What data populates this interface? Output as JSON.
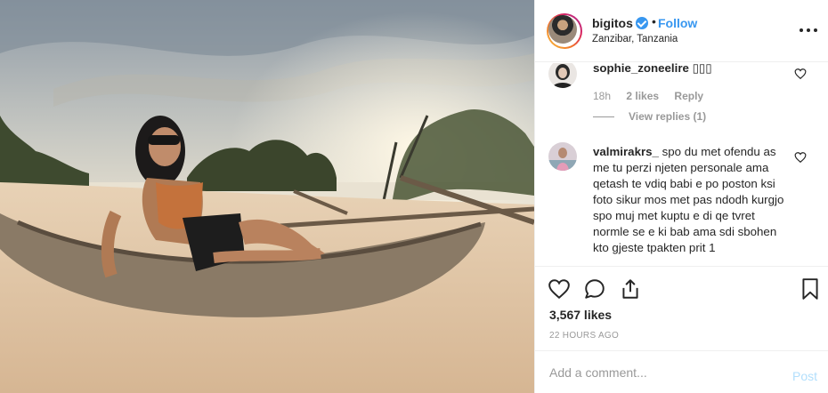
{
  "post": {
    "username": "bigitos",
    "follow_label": "Follow",
    "separator": "•",
    "location": "Zanzibar, Tanzania",
    "likes": "3,567 likes",
    "time_ago": "22 HOURS AGO"
  },
  "comments": [
    {
      "username": "sophie_zoneelire",
      "text": "▯▯▯",
      "time": "18h",
      "likes": "2 likes",
      "reply_label": "Reply",
      "view_replies": "View replies (1)"
    },
    {
      "username": "valmirakrs_",
      "text": "spo du met ofendu as me tu perzi njeten personale ama qetash te vdiq babi e po poston ksi foto sikur mos met pas ndodh kurgjo spo muj met kuptu e di qe tvret normle se e ki bab ama sdi sbohen kto gjeste tpakten prit 1"
    }
  ],
  "add_comment": {
    "placeholder": "Add a comment...",
    "post_label": "Post"
  },
  "icons": {
    "more": "more-options-icon",
    "verified": "verified-badge-icon",
    "like": "heart-icon",
    "comment": "comment-icon",
    "share": "share-icon",
    "save": "bookmark-icon"
  },
  "colors": {
    "accent": "#3897f0",
    "post_disabled": "#b2dffc",
    "muted": "#999999",
    "text": "#262626"
  }
}
